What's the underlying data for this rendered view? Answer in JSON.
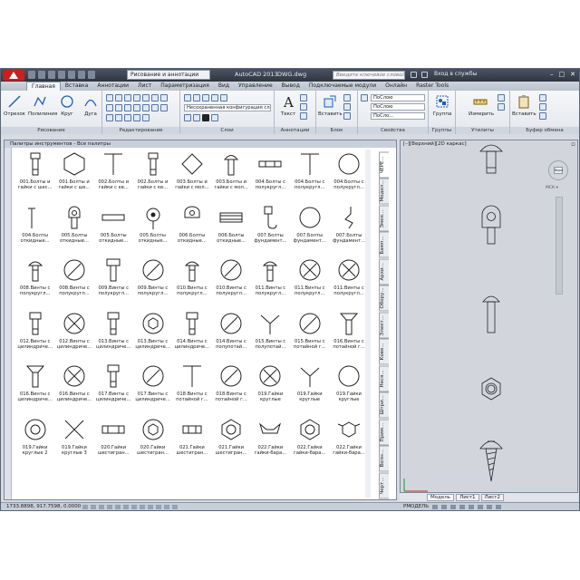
{
  "titlebar": {
    "workspace": "Рисование и аннотации",
    "app_title": "AutoCAD 2013",
    "file_name": "DWG.dwg",
    "search_placeholder": "Введите ключевое слово/фразу",
    "sign_in": "Вход в службы"
  },
  "tabs": [
    "Главная",
    "Вставка",
    "Аннотации",
    "Лист",
    "Параметризация",
    "Вид",
    "Управление",
    "Вывод",
    "Подключаемые модули",
    "Онлайн",
    "Raster Tools"
  ],
  "ribbon": {
    "draw": {
      "line": "Отрезок",
      "polyline": "Полилиния",
      "circle": "Круг",
      "arc": "Дуга",
      "title": "Рисование"
    },
    "modify": {
      "title": "Редактирование"
    },
    "layers": {
      "layer_state": "Несохраненная конфигурация сло",
      "title": "Слои"
    },
    "annotation": {
      "text": "Текст",
      "dim": "Размер",
      "title": "Аннотации"
    },
    "block": {
      "insert": "Вставить",
      "title": "Блок"
    },
    "properties": {
      "by_layer": "ПоСлою",
      "by_layer_2": "ПоСлою",
      "by_layer_3": "ПоСло...",
      "title": "Свойства"
    },
    "groups": {
      "group": "Группа",
      "title": "Группы"
    },
    "utilities": {
      "measure": "Измерить",
      "title": "Утилиты"
    },
    "clipboard": {
      "paste": "Вставить",
      "title": "Буфер обмена"
    }
  },
  "palette": {
    "title": "Палитры инструментов - Все палитры",
    "tabs": [
      "Черт...",
      "Волн...",
      "Прим...",
      "Штри...",
      "Неся...",
      "Кове...",
      "Элект...",
      "Обору...",
      "Архи...",
      "Бамп...",
      "Змея...",
      "Модел...",
      "ЧЕРЕ..."
    ],
    "items": [
      {
        "label": "001.Болты и гайки с шес...",
        "icon": "bolt-side"
      },
      {
        "label": "001.Болты и гайки с ше...",
        "icon": "hexagon"
      },
      {
        "label": "002.Болты и гайки с кв...",
        "icon": "t-bolt"
      },
      {
        "label": "002.Болты и гайки с кв...",
        "icon": "bolt-side"
      },
      {
        "label": "003.Болты и гайки с мол...",
        "icon": "diamond"
      },
      {
        "label": "003.Болты и гайки с мол...",
        "icon": "round-bolt"
      },
      {
        "label": "004.Болты с полукругл...",
        "icon": "bolt-horizontal"
      },
      {
        "label": "004.Болты с полукругл...",
        "icon": "t-bolt"
      },
      {
        "label": "004.Болты с полукругл...",
        "icon": "circle"
      },
      {
        "label": "004.Болты откидные...",
        "icon": "t-bolt-thin"
      },
      {
        "label": "005.Болты откидные...",
        "icon": "eye-bolt"
      },
      {
        "label": "005.Болты откидные...",
        "icon": "rect-horizontal"
      },
      {
        "label": "005.Болты откидные...",
        "icon": "eye-bolt-dot"
      },
      {
        "label": "006.Болты откидные...",
        "icon": "eye-bolt-side"
      },
      {
        "label": "006.Болты откидные...",
        "icon": "rect-lines"
      },
      {
        "label": "007.Болты фундамент...",
        "icon": "hook-bolt"
      },
      {
        "label": "007.Болты фундамент...",
        "icon": "circle"
      },
      {
        "label": "007.Болты фундамент...",
        "icon": "zigzag"
      },
      {
        "label": "008.Винты с полукругл...",
        "icon": "round-screw"
      },
      {
        "label": "008.Винты с полукругл...",
        "icon": "slot-circle"
      },
      {
        "label": "009.Винты с полукругл...",
        "icon": "screw-side"
      },
      {
        "label": "009.Винты с полукругл...",
        "icon": "slot-circle"
      },
      {
        "label": "010.Винты с полукругл...",
        "icon": "round-screw"
      },
      {
        "label": "010.Винты с полукругл...",
        "icon": "slot-circle"
      },
      {
        "label": "011.Винты с полукругл...",
        "icon": "round-screw"
      },
      {
        "label": "011.Винты с полукругл...",
        "icon": "cross-circle"
      },
      {
        "label": "011.Винты с полукругл...",
        "icon": "cross-circle"
      },
      {
        "label": "012.Винты с цилиндриче...",
        "icon": "cyl-screw"
      },
      {
        "label": "012.Винты с цилиндриче...",
        "icon": "cross-circle"
      },
      {
        "label": "013.Винты с цилиндриче...",
        "icon": "cyl-screw"
      },
      {
        "label": "013.Винты с цилиндриче...",
        "icon": "hex-circle"
      },
      {
        "label": "014.Винты с цилиндриче...",
        "icon": "cyl-screw"
      },
      {
        "label": "014.Винты с полупотай...",
        "icon": "slot-circle"
      },
      {
        "label": "015.Винты с полупотай...",
        "icon": "y-shape"
      },
      {
        "label": "015.Винты с потайной г...",
        "icon": "slot-circle"
      },
      {
        "label": "016.Винты с потайной г...",
        "icon": "countersunk"
      },
      {
        "label": "016.Винты с цилиндриче...",
        "icon": "countersunk"
      },
      {
        "label": "016.Винты с цилиндриче...",
        "icon": "cross-circle"
      },
      {
        "label": "017.Винты с цилиндриче...",
        "icon": "cyl-screw"
      },
      {
        "label": "017.Винты с цилиндриче...",
        "icon": "slot-circle"
      },
      {
        "label": "018.Винты с потайной г...",
        "icon": "t-bolt"
      },
      {
        "label": "018.Винты с потайной г...",
        "icon": "slot-circle"
      },
      {
        "label": "019.Гайки круглые",
        "icon": "cross-circle"
      },
      {
        "label": "019.Гайки круглые",
        "icon": "y-shape"
      },
      {
        "label": "019.Гайки круглые",
        "icon": "circle"
      },
      {
        "label": "019.Гайки круглые 2",
        "icon": "double-circle"
      },
      {
        "label": "019.Гайки круглые 3",
        "icon": "x-shape"
      },
      {
        "label": "020.Гайки шестигран...",
        "icon": "nut-side"
      },
      {
        "label": "020.Гайки шестигран...",
        "icon": "hex-circle"
      },
      {
        "label": "021.Гайки шестигран...",
        "icon": "nut-side-2"
      },
      {
        "label": "021.Гайки шестигран...",
        "icon": "hex-double"
      },
      {
        "label": "022.Гайки гайки-бара...",
        "icon": "wing-nut"
      },
      {
        "label": "022.Гайки гайки-бара...",
        "icon": "hex-double"
      },
      {
        "label": "022.Гайки гайки-бара...",
        "icon": "wing-hex"
      }
    ]
  },
  "viewport": {
    "label": "[–][Верхний][2D каркас]",
    "viewcube_face": "Верх",
    "wcs": "МСК ▾"
  },
  "layout_tabs": [
    "Модель",
    "Лист1",
    "Лист2"
  ],
  "statusbar": {
    "coords": "1733.8898, 917.7598, 0.0000",
    "model": "РМОДЕЛЬ"
  }
}
